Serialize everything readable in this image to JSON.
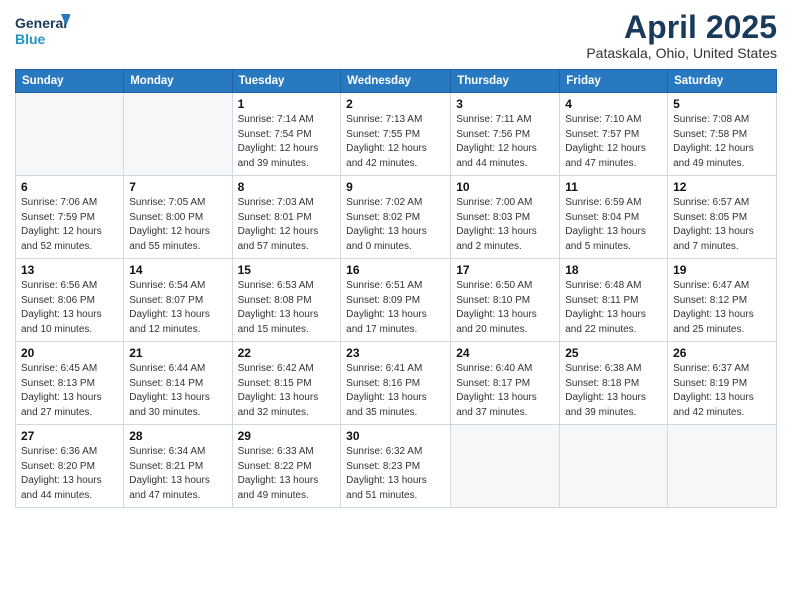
{
  "logo": {
    "line1": "General",
    "line2": "Blue"
  },
  "title": "April 2025",
  "subtitle": "Pataskala, Ohio, United States",
  "days_of_week": [
    "Sunday",
    "Monday",
    "Tuesday",
    "Wednesday",
    "Thursday",
    "Friday",
    "Saturday"
  ],
  "weeks": [
    [
      {
        "num": "",
        "detail": ""
      },
      {
        "num": "",
        "detail": ""
      },
      {
        "num": "1",
        "detail": "Sunrise: 7:14 AM\nSunset: 7:54 PM\nDaylight: 12 hours and 39 minutes."
      },
      {
        "num": "2",
        "detail": "Sunrise: 7:13 AM\nSunset: 7:55 PM\nDaylight: 12 hours and 42 minutes."
      },
      {
        "num": "3",
        "detail": "Sunrise: 7:11 AM\nSunset: 7:56 PM\nDaylight: 12 hours and 44 minutes."
      },
      {
        "num": "4",
        "detail": "Sunrise: 7:10 AM\nSunset: 7:57 PM\nDaylight: 12 hours and 47 minutes."
      },
      {
        "num": "5",
        "detail": "Sunrise: 7:08 AM\nSunset: 7:58 PM\nDaylight: 12 hours and 49 minutes."
      }
    ],
    [
      {
        "num": "6",
        "detail": "Sunrise: 7:06 AM\nSunset: 7:59 PM\nDaylight: 12 hours and 52 minutes."
      },
      {
        "num": "7",
        "detail": "Sunrise: 7:05 AM\nSunset: 8:00 PM\nDaylight: 12 hours and 55 minutes."
      },
      {
        "num": "8",
        "detail": "Sunrise: 7:03 AM\nSunset: 8:01 PM\nDaylight: 12 hours and 57 minutes."
      },
      {
        "num": "9",
        "detail": "Sunrise: 7:02 AM\nSunset: 8:02 PM\nDaylight: 13 hours and 0 minutes."
      },
      {
        "num": "10",
        "detail": "Sunrise: 7:00 AM\nSunset: 8:03 PM\nDaylight: 13 hours and 2 minutes."
      },
      {
        "num": "11",
        "detail": "Sunrise: 6:59 AM\nSunset: 8:04 PM\nDaylight: 13 hours and 5 minutes."
      },
      {
        "num": "12",
        "detail": "Sunrise: 6:57 AM\nSunset: 8:05 PM\nDaylight: 13 hours and 7 minutes."
      }
    ],
    [
      {
        "num": "13",
        "detail": "Sunrise: 6:56 AM\nSunset: 8:06 PM\nDaylight: 13 hours and 10 minutes."
      },
      {
        "num": "14",
        "detail": "Sunrise: 6:54 AM\nSunset: 8:07 PM\nDaylight: 13 hours and 12 minutes."
      },
      {
        "num": "15",
        "detail": "Sunrise: 6:53 AM\nSunset: 8:08 PM\nDaylight: 13 hours and 15 minutes."
      },
      {
        "num": "16",
        "detail": "Sunrise: 6:51 AM\nSunset: 8:09 PM\nDaylight: 13 hours and 17 minutes."
      },
      {
        "num": "17",
        "detail": "Sunrise: 6:50 AM\nSunset: 8:10 PM\nDaylight: 13 hours and 20 minutes."
      },
      {
        "num": "18",
        "detail": "Sunrise: 6:48 AM\nSunset: 8:11 PM\nDaylight: 13 hours and 22 minutes."
      },
      {
        "num": "19",
        "detail": "Sunrise: 6:47 AM\nSunset: 8:12 PM\nDaylight: 13 hours and 25 minutes."
      }
    ],
    [
      {
        "num": "20",
        "detail": "Sunrise: 6:45 AM\nSunset: 8:13 PM\nDaylight: 13 hours and 27 minutes."
      },
      {
        "num": "21",
        "detail": "Sunrise: 6:44 AM\nSunset: 8:14 PM\nDaylight: 13 hours and 30 minutes."
      },
      {
        "num": "22",
        "detail": "Sunrise: 6:42 AM\nSunset: 8:15 PM\nDaylight: 13 hours and 32 minutes."
      },
      {
        "num": "23",
        "detail": "Sunrise: 6:41 AM\nSunset: 8:16 PM\nDaylight: 13 hours and 35 minutes."
      },
      {
        "num": "24",
        "detail": "Sunrise: 6:40 AM\nSunset: 8:17 PM\nDaylight: 13 hours and 37 minutes."
      },
      {
        "num": "25",
        "detail": "Sunrise: 6:38 AM\nSunset: 8:18 PM\nDaylight: 13 hours and 39 minutes."
      },
      {
        "num": "26",
        "detail": "Sunrise: 6:37 AM\nSunset: 8:19 PM\nDaylight: 13 hours and 42 minutes."
      }
    ],
    [
      {
        "num": "27",
        "detail": "Sunrise: 6:36 AM\nSunset: 8:20 PM\nDaylight: 13 hours and 44 minutes."
      },
      {
        "num": "28",
        "detail": "Sunrise: 6:34 AM\nSunset: 8:21 PM\nDaylight: 13 hours and 47 minutes."
      },
      {
        "num": "29",
        "detail": "Sunrise: 6:33 AM\nSunset: 8:22 PM\nDaylight: 13 hours and 49 minutes."
      },
      {
        "num": "30",
        "detail": "Sunrise: 6:32 AM\nSunset: 8:23 PM\nDaylight: 13 hours and 51 minutes."
      },
      {
        "num": "",
        "detail": ""
      },
      {
        "num": "",
        "detail": ""
      },
      {
        "num": "",
        "detail": ""
      }
    ]
  ]
}
